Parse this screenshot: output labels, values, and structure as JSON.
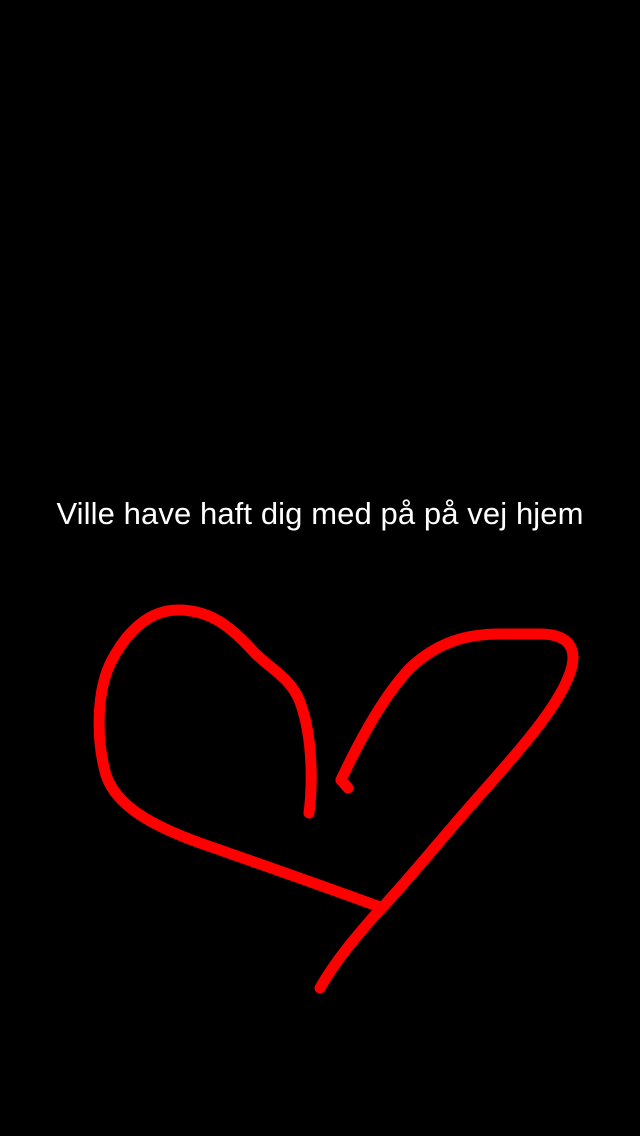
{
  "snap": {
    "caption": "Ville have haft dig med på på vej hjem",
    "drawing": {
      "subject": "heart-doodle",
      "stroke_color": "#ff0000"
    },
    "background_color": "#000000"
  }
}
